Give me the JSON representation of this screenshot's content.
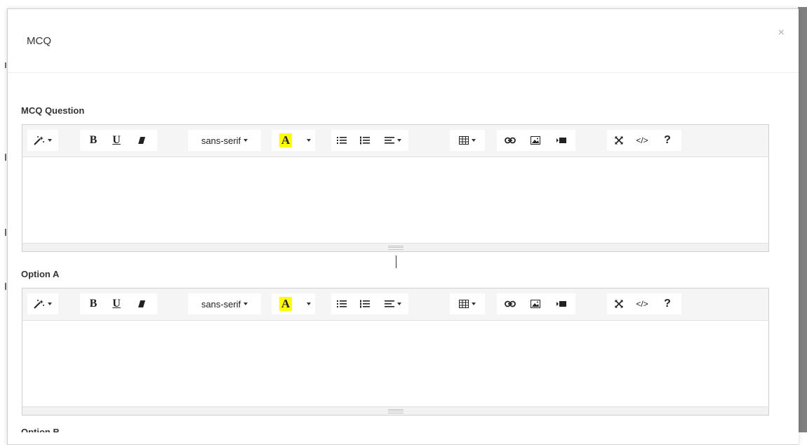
{
  "modal": {
    "title": "MCQ",
    "close_symbol": "×"
  },
  "fields": [
    {
      "label": "MCQ Question",
      "content": ""
    },
    {
      "label": "Option A",
      "content": ""
    }
  ],
  "next_field_label_partial": "Option B",
  "toolbar": {
    "style_icon": "magic-wand-icon",
    "bold_label": "B",
    "underline_label": "U",
    "clear_format_icon": "eraser-icon",
    "font_family": "sans-serif",
    "font_color_label": "A",
    "font_color_highlight": "#ffff00",
    "unordered_list_icon": "bullet-list-icon",
    "ordered_list_icon": "numbered-list-icon",
    "paragraph_icon": "align-left-icon",
    "table_icon": "table-icon",
    "link_icon": "link-icon",
    "picture_icon": "image-icon",
    "video_icon": "video-icon",
    "fullscreen_icon": "expand-icon",
    "codeview_label": "</>",
    "help_label": "?"
  }
}
